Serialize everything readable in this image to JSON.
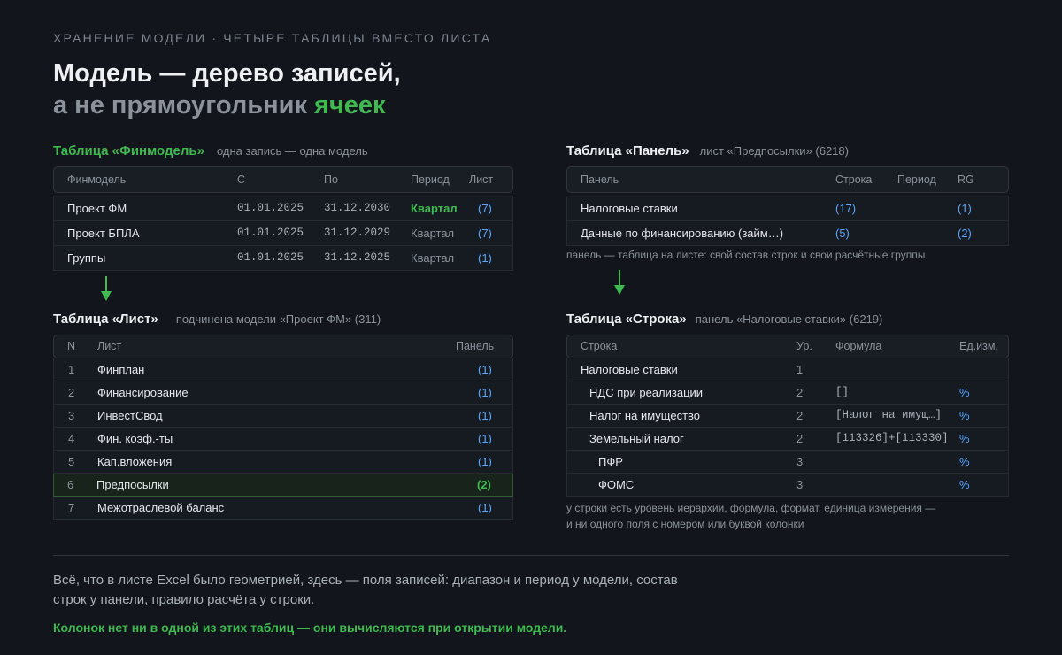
{
  "header": {
    "eyebrow": "ХРАНЕНИЕ МОДЕЛИ · ЧЕТЫРЕ ТАБЛИЦЫ ВМЕСТО ЛИСТА",
    "title_line1": "Модель — дерево записей,",
    "title_line2_prefix": "а не прямоугольник ",
    "title_line2_accent": "ячеек"
  },
  "finmodel": {
    "title": "Таблица «Финмодель»",
    "subtitle": "одна запись — одна модель",
    "columns": [
      "Финмодель",
      "С",
      "По",
      "Период",
      "Лист"
    ],
    "rows": [
      {
        "name": "Проект ФМ",
        "from": "01.01.2025",
        "to": "31.12.2030",
        "period": "Квартал",
        "count": "(7)"
      },
      {
        "name": "Проект БПЛА",
        "from": "01.01.2025",
        "to": "31.12.2029",
        "period": "Квартал",
        "count": "(7)"
      },
      {
        "name": "Группы",
        "from": "01.01.2025",
        "to": "31.12.2025",
        "period": "Квартал",
        "count": "(1)"
      }
    ]
  },
  "panel": {
    "title": "Таблица «Панель»",
    "subtitle": "лист «Предпосылки» (6218)",
    "columns": [
      "Панель",
      "Строка",
      "Период",
      "RG"
    ],
    "rows": [
      {
        "name": "Налоговые ставки",
        "rows": "(17)",
        "period": "",
        "rg": "(1)"
      },
      {
        "name": "Данные по финансированию (займ…)",
        "rows": "(5)",
        "period": "",
        "rg": "(2)"
      }
    ],
    "note": "панель — таблица на листе: свой состав строк и свои расчётные группы"
  },
  "sheet": {
    "title": "Таблица «Лист»",
    "subtitle": "подчинена модели «Проект ФМ» (311)",
    "columns": [
      "N",
      "Лист",
      "Панель"
    ],
    "rows": [
      {
        "n": "1",
        "name": "Финплан",
        "panels": "(1)"
      },
      {
        "n": "2",
        "name": "Финансирование",
        "panels": "(1)"
      },
      {
        "n": "3",
        "name": "ИнвестСвод",
        "panels": "(1)"
      },
      {
        "n": "4",
        "name": "Фин. коэф.-ты",
        "panels": "(1)"
      },
      {
        "n": "5",
        "name": "Кап.вложения",
        "panels": "(1)"
      },
      {
        "n": "6",
        "name": "Предпосылки",
        "panels": "(2)"
      },
      {
        "n": "7",
        "name": "Межотраслевой баланс",
        "panels": "(1)"
      }
    ]
  },
  "row_table": {
    "title": "Таблица «Строка»",
    "subtitle": "панель «Налоговые ставки» (6219)",
    "columns": [
      "Строка",
      "Ур.",
      "Формула",
      "Ед.изм."
    ],
    "rows": [
      {
        "name": "Налоговые ставки",
        "level": "1",
        "formula": "",
        "unit": ""
      },
      {
        "name": "НДС при реализации",
        "level": "2",
        "formula": "[]",
        "unit": "%"
      },
      {
        "name": "Налог на имущество",
        "level": "2",
        "formula": "[Налог на имущ…]",
        "unit": "%"
      },
      {
        "name": "Земельный налог",
        "level": "2",
        "formula": "[113326]+[113330]",
        "unit": "%"
      },
      {
        "name": "ПФР",
        "level": "3",
        "formula": "",
        "unit": "%"
      },
      {
        "name": "ФОМС",
        "level": "3",
        "formula": "",
        "unit": "%"
      }
    ],
    "note_line1": "у строки есть уровень иерархии, формула, формат, единица измерения —",
    "note_line2": "и ни одного поля с номером или буквой колонки"
  },
  "footer": {
    "text": "Всё, что в листе Excel было геометрией, здесь — поля записей: диапазон и период у модели, состав строк у панели, правило расчёта у строки.",
    "accent": "Колонок нет ни в одной из этих таблиц — они вычисляются при открытии модели."
  },
  "colors": {
    "background": "#12151b",
    "accent_green": "#3fb950",
    "link_blue": "#58a6ff"
  }
}
